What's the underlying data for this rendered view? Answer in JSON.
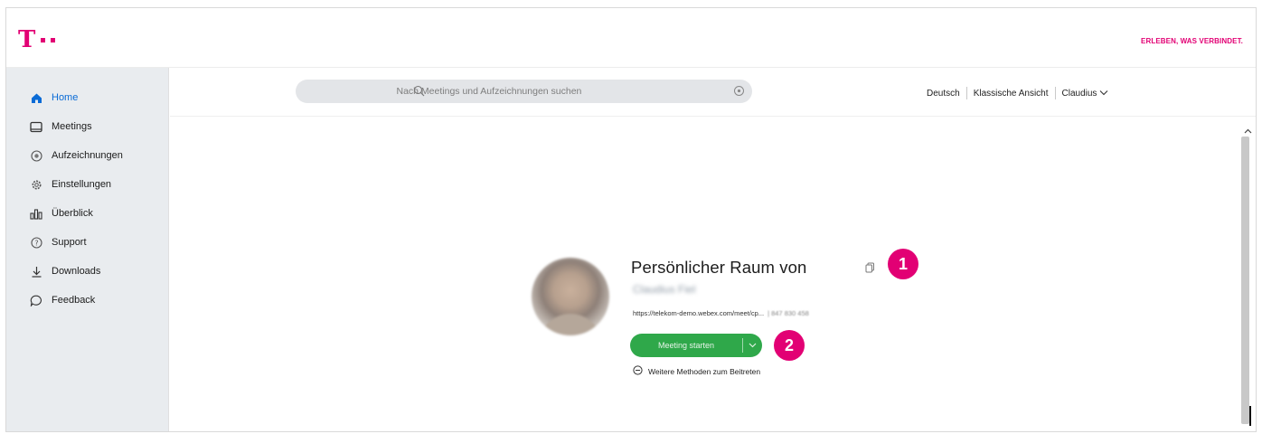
{
  "colors": {
    "magenta": "#e20074",
    "link_blue": "#0a6bd6",
    "green": "#2fa84a"
  },
  "brand": {
    "logo_letter": "T",
    "slogan": "ERLEBEN, WAS VERBINDET."
  },
  "sidebar": {
    "items": [
      {
        "label": "Home",
        "icon": "home-icon"
      },
      {
        "label": "Meetings",
        "icon": "calendar-icon"
      },
      {
        "label": "Aufzeichnungen",
        "icon": "recording-icon"
      },
      {
        "label": "Einstellungen",
        "icon": "gear-icon"
      },
      {
        "label": "Überblick",
        "icon": "chart-icon"
      },
      {
        "label": "Support",
        "icon": "help-icon"
      },
      {
        "label": "Downloads",
        "icon": "download-icon"
      },
      {
        "label": "Feedback",
        "icon": "feedback-icon"
      }
    ]
  },
  "header": {
    "search_placeholder": "Nach Meetings und Aufzeichnungen suchen",
    "language": "Deutsch",
    "classic_view": "Klassische Ansicht",
    "user": "Claudius"
  },
  "room": {
    "title": "Persönlicher Raum von",
    "owner": "Claudius Fiel",
    "link": "https://telekom-demo.webex.com/meet/cp...",
    "number": "| 847 830 458",
    "start_label": "Meeting starten",
    "more_methods": "Weitere Methoden zum Beitreten"
  },
  "markers": [
    "1",
    "2"
  ]
}
